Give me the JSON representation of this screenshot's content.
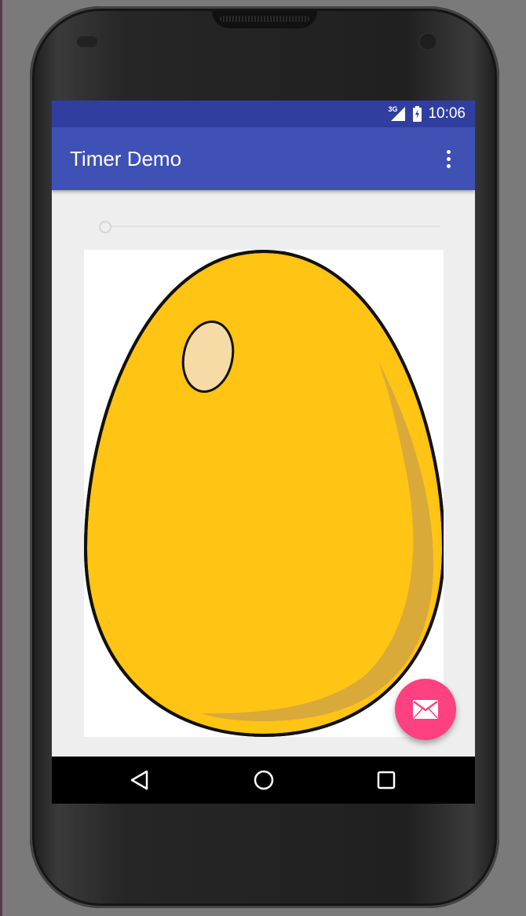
{
  "status_bar": {
    "network": "3G",
    "time": "10:06"
  },
  "app_bar": {
    "title": "Timer Demo",
    "overflow_icon": "more-vert-icon"
  },
  "timer": {
    "seekbar_progress": 0
  },
  "content": {
    "image_icon": "golden-egg-image"
  },
  "fab": {
    "icon": "mail-icon",
    "color": "#ff4081"
  },
  "nav_bar": {
    "buttons": [
      "back-icon",
      "home-icon",
      "recents-icon"
    ]
  },
  "colors": {
    "primary": "#3f51b5",
    "primary_dark": "#303f9f",
    "accent": "#ff4081",
    "egg": "#ffc414"
  }
}
